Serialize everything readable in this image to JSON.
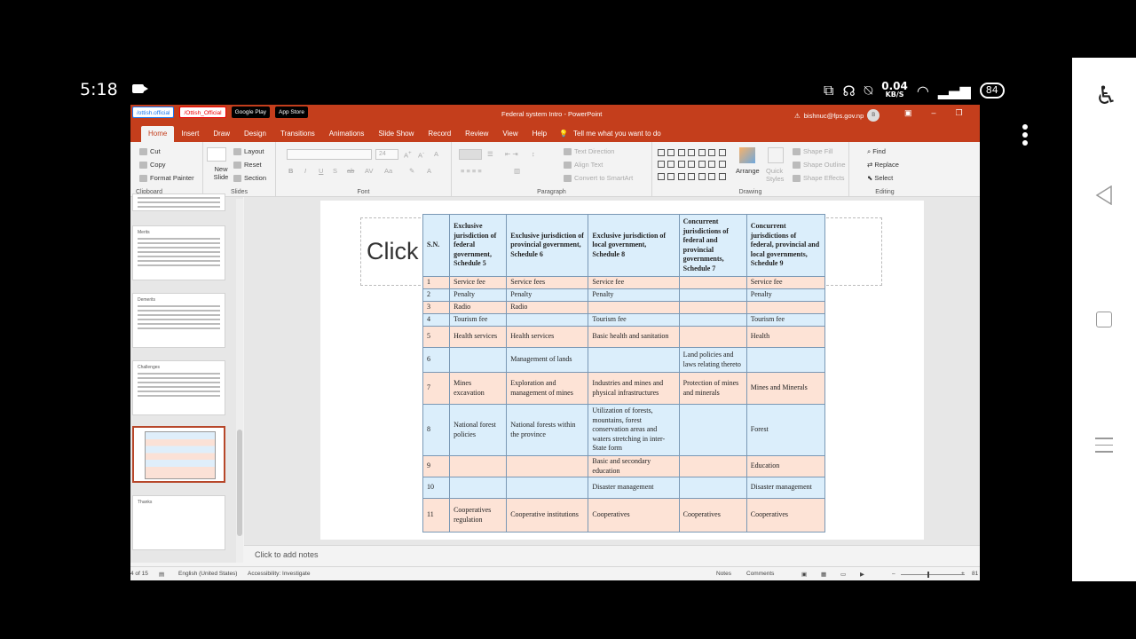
{
  "status": {
    "time": "5:18",
    "speed_value": "0.04",
    "speed_unit": "KB/S",
    "battery": "84"
  },
  "badges": [
    "/ottish.official",
    "/Ottish_Official",
    "Google Play",
    "App Store"
  ],
  "window": {
    "title": "Federal system Intro  -  PowerPoint",
    "account": "bishnuc@fps.gov.np",
    "avatar": "B"
  },
  "tabs": [
    "Home",
    "Insert",
    "Draw",
    "Design",
    "Transitions",
    "Animations",
    "Slide Show",
    "Record",
    "Review",
    "View",
    "Help"
  ],
  "tell_me": "Tell me what you want to do",
  "ribbon": {
    "clipboard": {
      "cut": "Cut",
      "copy": "Copy",
      "format_painter": "Format Painter",
      "label": "Clipboard"
    },
    "slides": {
      "new_slide": "New Slide",
      "layout": "Layout",
      "reset": "Reset",
      "section": "Section",
      "label": "Slides"
    },
    "font": {
      "size": "24",
      "label": "Font"
    },
    "paragraph": {
      "text_direction": "Text Direction",
      "align_text": "Align Text",
      "smartart": "Convert to SmartArt",
      "label": "Paragraph"
    },
    "drawing": {
      "arrange": "Arrange",
      "quick_styles": "Quick Styles",
      "shape_fill": "Shape Fill",
      "shape_outline": "Shape Outline",
      "shape_effects": "Shape Effects",
      "label": "Drawing"
    },
    "editing": {
      "find": "Find",
      "replace": "Replace",
      "select": "Select",
      "label": "Editing"
    }
  },
  "thumbs": [
    {
      "title": ""
    },
    {
      "title": "Merits"
    },
    {
      "title": "Demerits"
    },
    {
      "title": "Challenges"
    },
    {
      "title": ""
    },
    {
      "title": "Thanks"
    }
  ],
  "slide": {
    "title_placeholder": "Click",
    "headers": [
      "S.N.",
      "Exclusive jurisdiction of federal government, Schedule 5",
      "Exclusive jurisdiction of provincial government, Schedule 6",
      "Exclusive jurisdiction of local government, Schedule 8",
      "Concurrent jurisdictions of federal and provincial governments, Schedule 7",
      "Concurrent jurisdictions of federal, provincial and local governments, Schedule 9"
    ],
    "rows": [
      [
        "1",
        "Service fee",
        "Service fees",
        "Service fee",
        "",
        "Service fee"
      ],
      [
        "2",
        "Penalty",
        "Penalty",
        "Penalty",
        "",
        "Penalty"
      ],
      [
        "3",
        "Radio",
        "Radio",
        "",
        "",
        ""
      ],
      [
        "4",
        "Tourism fee",
        "",
        "Tourism fee",
        "",
        "Tourism fee"
      ],
      [
        "5",
        "Health services",
        "Health services",
        "Basic health and sanitation",
        "",
        "Health"
      ],
      [
        "6",
        "",
        "Management of lands",
        "",
        "Land policies and laws relating thereto",
        ""
      ],
      [
        "7",
        "Mines excavation",
        "Exploration and management of mines",
        "Industries and mines and physical infrastructures",
        "Protection of mines and minerals",
        "Mines and Minerals"
      ],
      [
        "8",
        "National forest policies",
        "National forests within the province",
        "Utilization of forests, mountains, forest conservation areas and waters stretching in inter-State form",
        "",
        "Forest"
      ],
      [
        "9",
        "",
        "",
        "Basic and secondary education",
        "",
        "Education"
      ],
      [
        "10",
        "",
        "",
        "Disaster management",
        "",
        "Disaster management"
      ],
      [
        "11",
        "Cooperatives regulation",
        "Cooperative institutions",
        "Cooperatives",
        "Cooperatives",
        "Cooperatives"
      ]
    ]
  },
  "notes_placeholder": "Click to add notes",
  "statusbar": {
    "slide_count": "4 of 15",
    "language": "English (United States)",
    "accessibility": "Accessibility: Investigate",
    "notes": "Notes",
    "comments": "Comments",
    "zoom": "81"
  }
}
